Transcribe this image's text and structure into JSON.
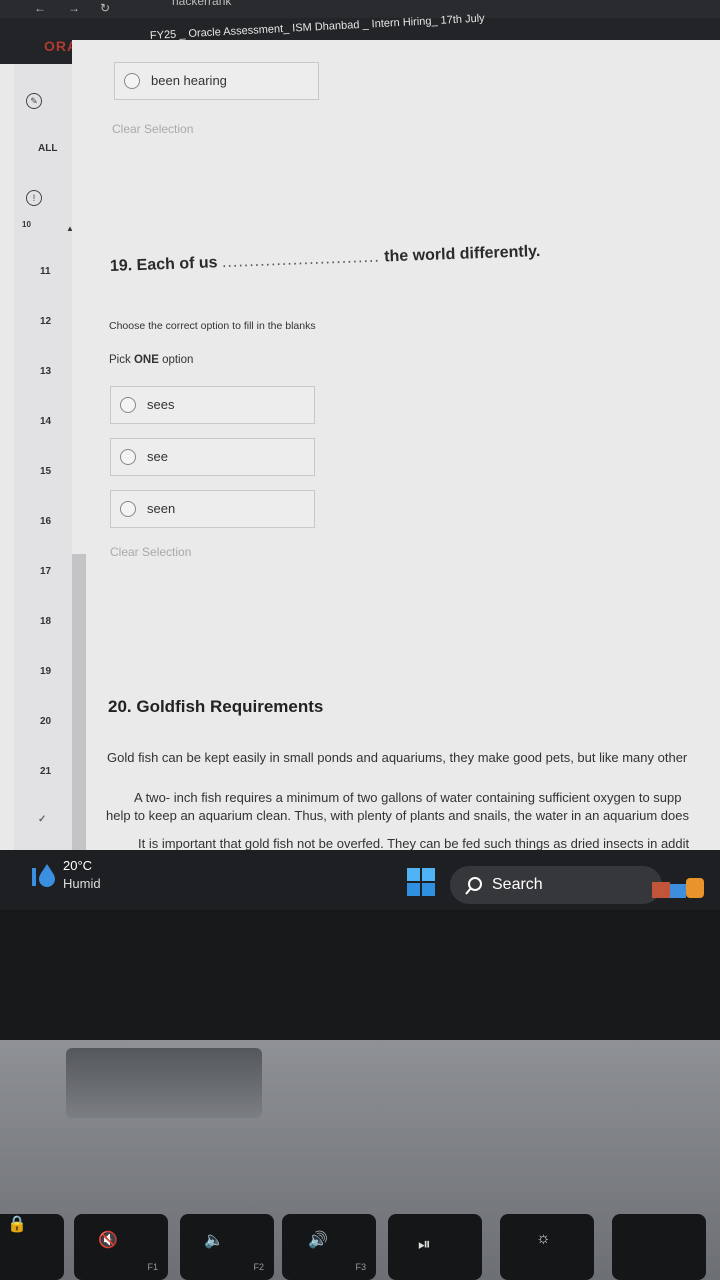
{
  "browser": {
    "title_fragment": "hackerrank"
  },
  "header": {
    "logo": "ORACLE",
    "title": "FY25 _ Oracle Assessment_ ISM Dhanbad _ Intern Hiring_ 17th July"
  },
  "sidebar": {
    "all_label": "ALL",
    "partial_item": "10",
    "items": [
      "11",
      "12",
      "13",
      "14",
      "15",
      "16",
      "17",
      "18",
      "19",
      "20",
      "21"
    ]
  },
  "prev_question": {
    "option_label": "been hearing",
    "clear": "Clear Selection"
  },
  "q19": {
    "prefix": "19. Each of us",
    "blank": ".............................",
    "suffix": "the world differently.",
    "instruction": "Choose the correct option to fill in the blanks",
    "pick_prefix": "Pick",
    "pick_bold": "ONE",
    "pick_suffix": "option",
    "options": [
      "sees",
      "see",
      "seen"
    ],
    "clear": "Clear Selection"
  },
  "q20": {
    "title": "20. Goldfish Requirements",
    "para1": "Gold fish can be kept easily in small ponds and aquariums, they make good pets, but like many other",
    "para2a": "A two- inch fish requires a minimum of two gallons of water containing sufficient oxygen to supp",
    "para2b": "help to keep an aquarium clean. Thus, with plenty of plants and snails, the water in an aquarium does",
    "para3": "It is important that gold fish not be overfed. They can be fed such things as dried insects in addit"
  },
  "taskbar": {
    "temp": "20°C",
    "weather": "Humid",
    "search": "Search",
    "start_icon": "windows-icon",
    "weather_icon": "raindrop-icon"
  },
  "keyboard": {
    "f1": "F1",
    "f2": "F2",
    "f3": "F3"
  }
}
